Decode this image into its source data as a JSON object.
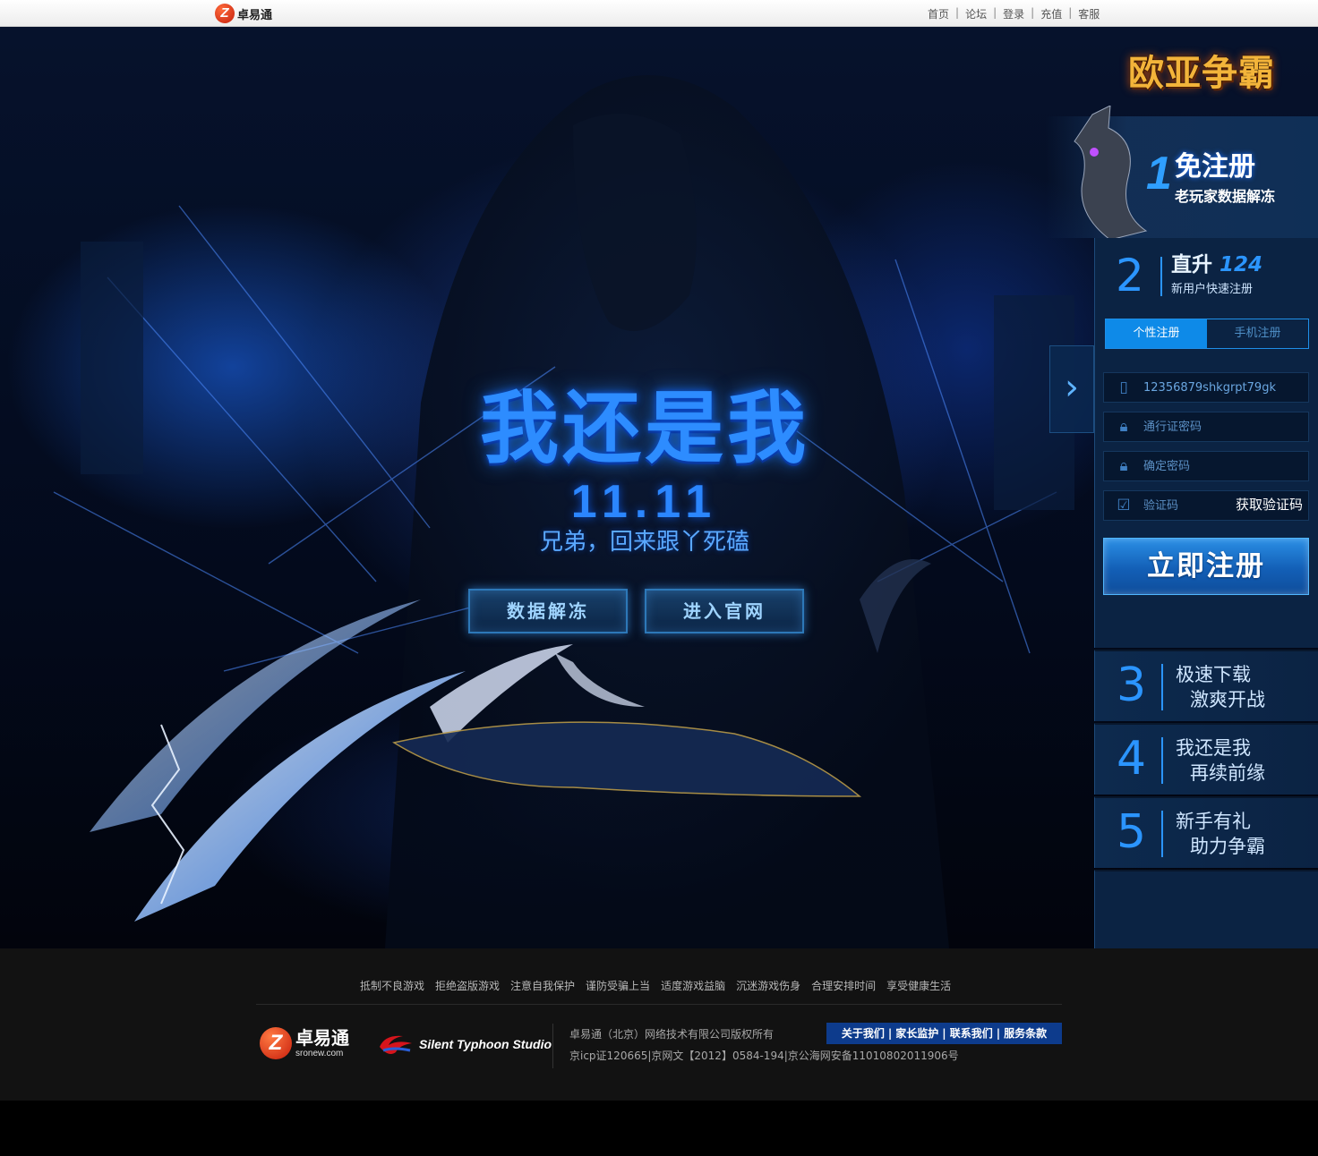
{
  "topbar": {
    "brand": "卓易通",
    "brand_mark": "Z",
    "nav": [
      "首页",
      "论坛",
      "登录",
      "充值",
      "客服"
    ],
    "separator": "|"
  },
  "hero": {
    "title": "我还是我",
    "date": "11.11",
    "subtitle": "兄弟，回来跟丫死磕",
    "buttons": {
      "unfreeze": "数据解冻",
      "official": "进入官网"
    },
    "side_arrow": "chevron-right-icon"
  },
  "panel": {
    "game_logo": "欧亚争霸",
    "step1": {
      "num": "1",
      "title": "免注册",
      "sub": "老玩家数据解冻"
    },
    "step2": {
      "num": "2",
      "title": "直升",
      "level": "124",
      "sub": "新用户快速注册"
    },
    "tabs": {
      "custom": "个性注册",
      "phone": "手机注册"
    },
    "fields": {
      "username": {
        "value": "12356879shkgrpt79gk",
        "icon": "phone-icon"
      },
      "password": {
        "placeholder": "通行证密码",
        "icon": "lock-icon"
      },
      "confirm": {
        "placeholder": "确定密码",
        "icon": "lock-icon"
      },
      "captcha": {
        "placeholder": "验证码",
        "icon": "checkbox-icon",
        "get_code": "获取验证码"
      }
    },
    "register_button": "立即注册",
    "steps": [
      {
        "num": "3",
        "line1": "极速下载",
        "line2": "激爽开战"
      },
      {
        "num": "4",
        "line1": "我还是我",
        "line2": "再续前缘"
      },
      {
        "num": "5",
        "line1": "新手有礼",
        "line2": "助力争霸"
      }
    ]
  },
  "footer": {
    "links": [
      "抵制不良游戏",
      "拒绝盗版游戏",
      "注意自我保护",
      "谨防受骗上当",
      "适度游戏益脑",
      "沉迷游戏伤身",
      "合理安排时间",
      "享受健康生活"
    ],
    "logo_name": "卓易通",
    "logo_mark": "Z",
    "logo_domain": "sronew.com",
    "studio": "Silent Typhoon Studio",
    "copyright": "卓易通（北京）网络技术有限公司版权所有",
    "icp": "京icp证120665|京网文【2012】0584-194|京公海网安备11010802011906号",
    "about_nav": [
      "关于我们",
      "家长监护",
      "联系我们",
      "服务条款"
    ],
    "separator": "|"
  },
  "colors": {
    "accent": "#2b95ff",
    "panel": "#0b2343",
    "footer": "#121212",
    "gold": "#f3b43a"
  }
}
